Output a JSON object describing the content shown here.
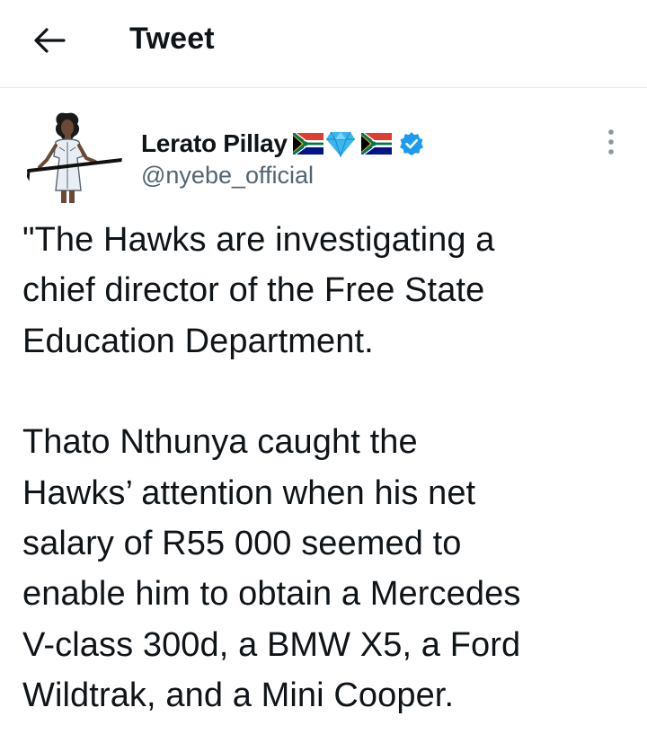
{
  "header": {
    "title": "Tweet",
    "back_icon": "arrow-left-icon"
  },
  "author": {
    "display_name": "Lerato Pillay",
    "name_emojis": [
      "south-africa-flag",
      "gem-stone",
      "south-africa-flag"
    ],
    "verified": true,
    "verified_icon": "verified-badge-icon",
    "handle": "@nyebe_official",
    "avatar_icon": "profile-photo"
  },
  "tweet": {
    "paragraph_1": "\"The Hawks are investigating a\nchief director of the Free State\nEducation Department.",
    "paragraph_2": "Thato Nthunya caught the\nHawks’ attention when his net\nsalary of R55 000 seemed to\nenable him to obtain a Mercedes\nV-class 300d, a BMW X5, a Ford\nWildtrak, and a Mini Cooper."
  },
  "colors": {
    "text": "#0f1419",
    "secondary_text": "#536471",
    "verified_blue": "#1d9bf0",
    "divider": "#e6e9ec"
  }
}
